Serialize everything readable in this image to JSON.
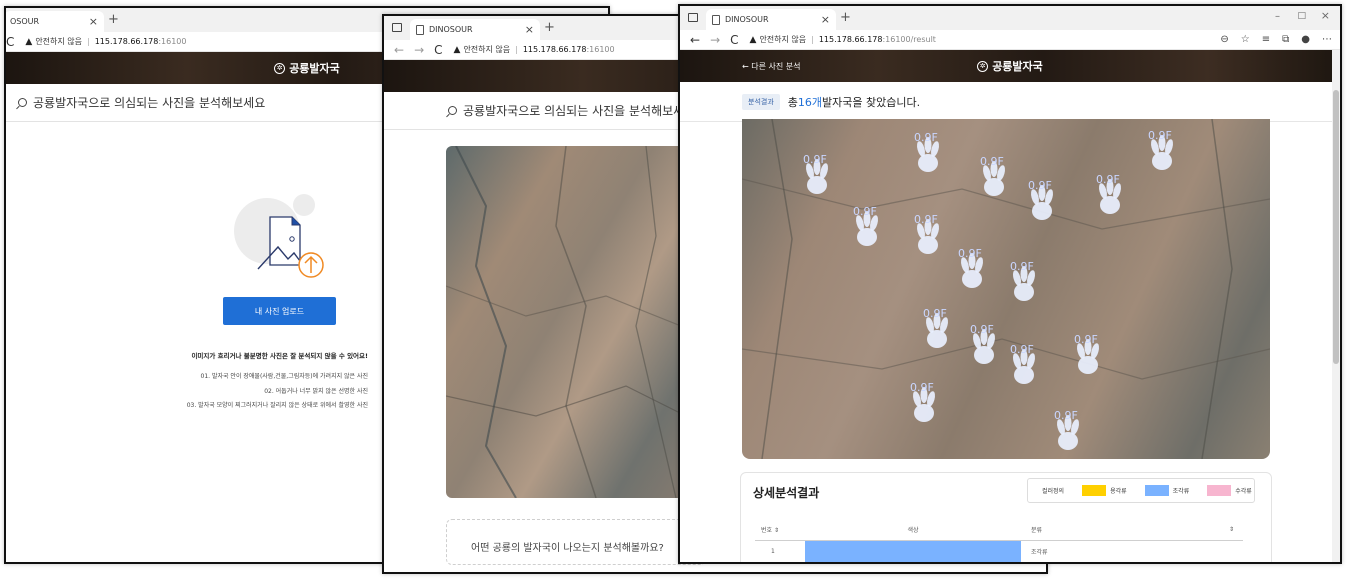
{
  "window1": {
    "tab_title": "DINOSOUR",
    "tab_title_visible": "OSOUR",
    "address": {
      "insecure": "안전하지 않음",
      "host": "115.178.66.178",
      "path": ":16100"
    },
    "header_title": "공룡발자국",
    "search_prompt": "공룡발자국으로 의심되는 사진을 분석해보세요",
    "upload_button": "내 사진 업로드",
    "tip_title": "이미지가 흐리거나 불분명한 사진은 잘 분석되지 않을 수 있어요!",
    "tips": [
      "01. 발자국 안이 장애물(사람,건물,그림자등)에 가려지지 않은 사진",
      "02. 어둡거나 너무 밝지 않은 선명한 사진",
      "03. 발자국 모양이 찌그러지거나 잘리지 않은 상태로 위에서 촬영한 사진"
    ]
  },
  "window2": {
    "tab_title": "DINOSOUR",
    "address": {
      "insecure": "안전하지 않음",
      "host": "115.178.66.178",
      "path": ":16100"
    },
    "search_prompt": "공룡발자국으로 의심되는 사진을 분석해보세요",
    "question": "어떤 공룡의 발자국이 나오는지 분석해볼까요?"
  },
  "window3": {
    "tab_title": "DINOSOUR",
    "address": {
      "insecure": "안전하지 않음",
      "host": "115.178.66.178",
      "path": ":16100/result"
    },
    "back_link": "← 다른 사진 분석",
    "header_title": "공룡발자국",
    "result_badge": "분석결과",
    "result_prefix": "총 ",
    "result_count": "16개",
    "result_suffix": " 발자국을 찾았습니다.",
    "footprint_label": "0.9F",
    "detail_title": "상세분석결과",
    "legend": {
      "label": "컬러정의",
      "items": [
        {
          "name": "용각류",
          "color": "#ffd000"
        },
        {
          "name": "조각류",
          "color": "#7ab2ff"
        },
        {
          "name": "수각류",
          "color": "#f7b5cf"
        }
      ]
    },
    "table": {
      "headers": [
        "번호",
        "색상",
        "분류"
      ],
      "rows": [
        {
          "num": "1",
          "color": "#7ab2ff",
          "category": "조각류"
        }
      ]
    }
  }
}
